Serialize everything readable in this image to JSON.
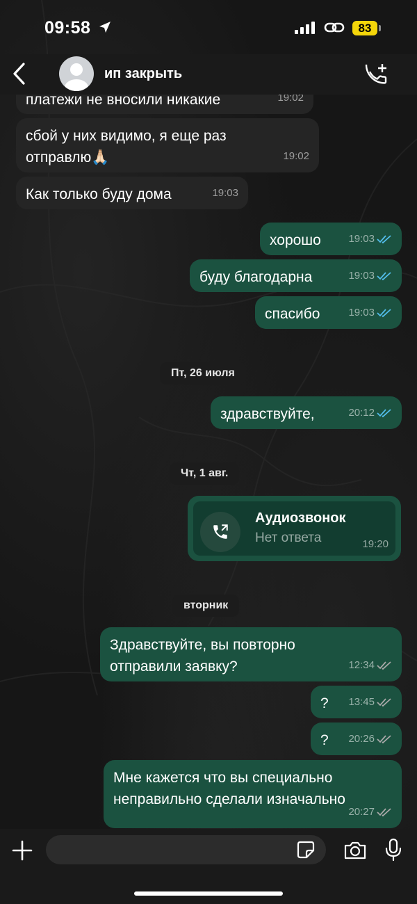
{
  "status_bar": {
    "time": "09:58",
    "battery": "83"
  },
  "header": {
    "contact_name": "ип закрыть"
  },
  "messages": [
    {
      "dir": "in",
      "text": "платежи не вносили никакие",
      "time": "19:02"
    },
    {
      "dir": "in",
      "text": "сбой у них видимо, я еще раз\nотправлю🙏🏻",
      "time": "19:02"
    },
    {
      "dir": "in",
      "text": "Как только буду дома",
      "time": "19:03"
    },
    {
      "dir": "out",
      "text": "хорошо",
      "time": "19:03",
      "read": true
    },
    {
      "dir": "out",
      "text": "буду благодарна",
      "time": "19:03",
      "read": true
    },
    {
      "dir": "out",
      "text": "спасибо",
      "time": "19:03",
      "read": true
    },
    {
      "dir": "out",
      "text": "здравствуйте,",
      "time": "20:12",
      "read": true
    },
    {
      "dir": "out",
      "text": "Здравствуйте, вы повторно\nотправили заявку?",
      "time": "12:34",
      "read": false
    },
    {
      "dir": "out",
      "text": "?",
      "time": "13:45",
      "read": false
    },
    {
      "dir": "out",
      "text": "?",
      "time": "20:26",
      "read": false
    },
    {
      "dir": "out",
      "text": "Мне кажется что вы специально\nнеправильно сделали изначально",
      "time": "20:27",
      "read": false
    }
  ],
  "dates": [
    "Пт, 26 июля",
    "Чт, 1 авг.",
    "вторник"
  ],
  "call": {
    "title": "Аудиозвонок",
    "status": "Нет ответа",
    "time": "19:20"
  },
  "colors": {
    "outgoing_bubble": "#1b5240",
    "incoming_bubble": "#252525",
    "read_tick": "#53bdeb",
    "battery": "#f5d60a"
  },
  "icons": [
    "location-arrow-icon",
    "signal-icon",
    "link-icon",
    "back-icon",
    "avatar-icon",
    "call-add-icon",
    "missed-call-icon",
    "plus-icon",
    "sticker-icon",
    "camera-icon",
    "mic-icon"
  ]
}
